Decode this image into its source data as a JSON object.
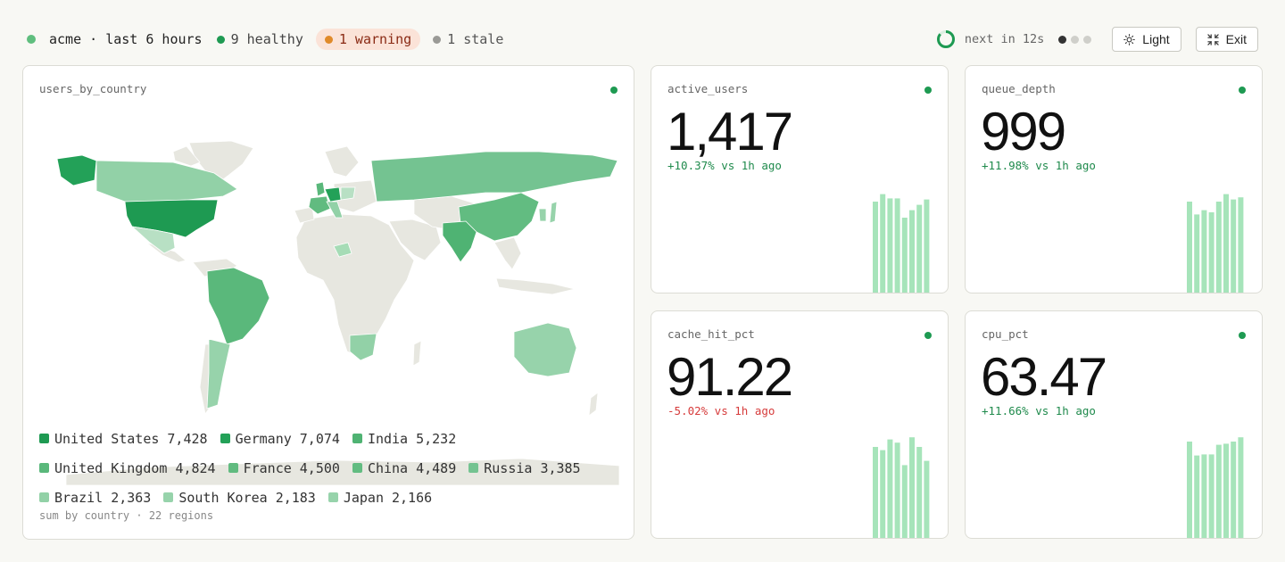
{
  "header": {
    "title": "acme · last 6 hours",
    "healthy": "9 healthy",
    "warning": "1 warning",
    "stale": "1 stale",
    "next_refresh": "next in 12s",
    "light_button": "Light",
    "exit_button": "Exit",
    "pages": 3,
    "active_page": 0
  },
  "map": {
    "title": "users_by_country",
    "legend": [
      {
        "name": "United States",
        "value": "7,428",
        "color": "#1e9a52"
      },
      {
        "name": "Germany",
        "value": "7,074",
        "color": "#23a158"
      },
      {
        "name": "India",
        "value": "5,232",
        "color": "#4fb373"
      },
      {
        "name": "United Kingdom",
        "value": "4,824",
        "color": "#5ab87b"
      },
      {
        "name": "France",
        "value": "4,500",
        "color": "#61bb80"
      },
      {
        "name": "China",
        "value": "4,489",
        "color": "#62bc81"
      },
      {
        "name": "Russia",
        "value": "3,385",
        "color": "#74c391"
      },
      {
        "name": "Brazil",
        "value": "2,363",
        "color": "#92d1a7"
      },
      {
        "name": "South Korea",
        "value": "2,183",
        "color": "#97d3ab"
      },
      {
        "name": "Japan",
        "value": "2,166",
        "color": "#97d3ab"
      }
    ],
    "footer": "sum by country · 22 regions"
  },
  "metrics": {
    "active": {
      "title": "active_users",
      "value": "1,417",
      "delta": "+10.37% vs 1h ago",
      "spark": [
        0.85,
        0.92,
        0.88,
        0.88,
        0.7,
        0.77,
        0.82,
        0.87
      ]
    },
    "queue": {
      "title": "queue_depth",
      "value": "999",
      "delta": "+11.98% vs 1h ago",
      "spark": [
        0.85,
        0.73,
        0.77,
        0.75,
        0.85,
        0.92,
        0.87,
        0.89
      ]
    },
    "cache": {
      "title": "cache_hit_pct",
      "value": "91.22",
      "delta": "-5.02% vs 1h ago",
      "spark": [
        0.85,
        0.82,
        0.92,
        0.89,
        0.68,
        0.94,
        0.85,
        0.72
      ]
    },
    "cpu": {
      "title": "cpu_pct",
      "value": "63.47",
      "delta": "+11.66% vs 1h ago",
      "spark": [
        0.9,
        0.77,
        0.78,
        0.78,
        0.87,
        0.88,
        0.9,
        0.94
      ]
    }
  },
  "colors": {
    "healthy": "#1e9a52",
    "warning": "#e08a2a",
    "stale": "#9a9a96",
    "spark": "#a6e4ba",
    "land": "#e7e7e0",
    "delta_up": "#1f8a4c",
    "delta_down": "#d63b3b"
  }
}
